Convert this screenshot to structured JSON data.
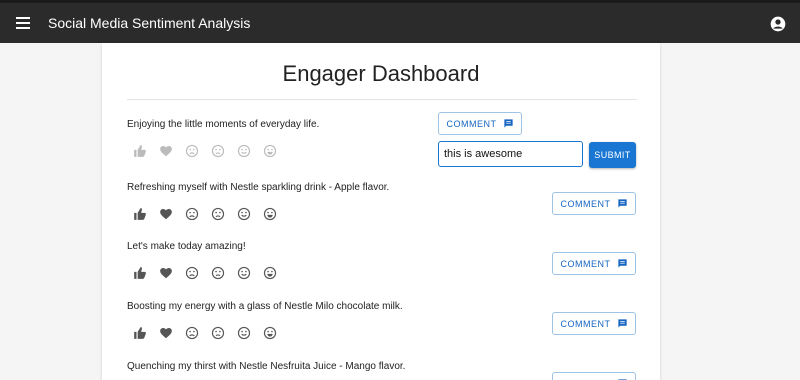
{
  "appbar": {
    "title": "Social Media Sentiment Analysis"
  },
  "dashboard": {
    "title": "Engager Dashboard"
  },
  "comment_label": "COMMENT",
  "submit_label": "SUBMIT",
  "active_comment": {
    "value": "this is awesome"
  },
  "colors": {
    "appbar": "#2b2b2b",
    "accent": "#1976d2"
  },
  "reaction_icons": [
    "thumb-up-icon",
    "heart-icon",
    "sad-face-icon",
    "frown-face-icon",
    "smile-face-icon",
    "grin-face-icon"
  ],
  "posts": [
    {
      "text": "Enjoying the little moments of everyday life."
    },
    {
      "text": "Refreshing myself with Nestle sparkling drink - Apple flavor."
    },
    {
      "text": "Let's make today amazing!"
    },
    {
      "text": "Boosting my energy with a glass of Nestle Milo chocolate milk."
    },
    {
      "text": "Quenching my thirst with Nestle Nesfruita Juice - Mango flavor."
    }
  ]
}
